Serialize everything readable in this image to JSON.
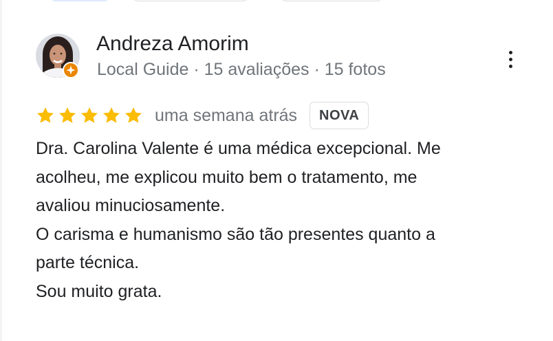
{
  "reviewer": {
    "name": "Andreza Amorim",
    "meta": "Local Guide · 15 avaliações · 15 fotos"
  },
  "review": {
    "rating": 5,
    "rating_max": 5,
    "date": "uma semana atrás",
    "badge": "NOVA",
    "lines": [
      "Dra. Carolina Valente é uma médica excepcional. Me",
      "acolheu, me explicou muito bem o tratamento, me",
      "avaliou minuciosamente.",
      "O carisma e humanismo são tão presentes quanto a",
      "parte técnica.",
      "Sou muito grata."
    ]
  },
  "icons": {
    "avatar": "reviewer-avatar",
    "badge": "local-guide-icon",
    "more": "more-vert-icon",
    "star": "star-icon"
  },
  "colors": {
    "star": "#fbbc04",
    "local_guide_badge": "#ea8600",
    "secondary_text": "#70757a",
    "primary_text": "#202124"
  }
}
